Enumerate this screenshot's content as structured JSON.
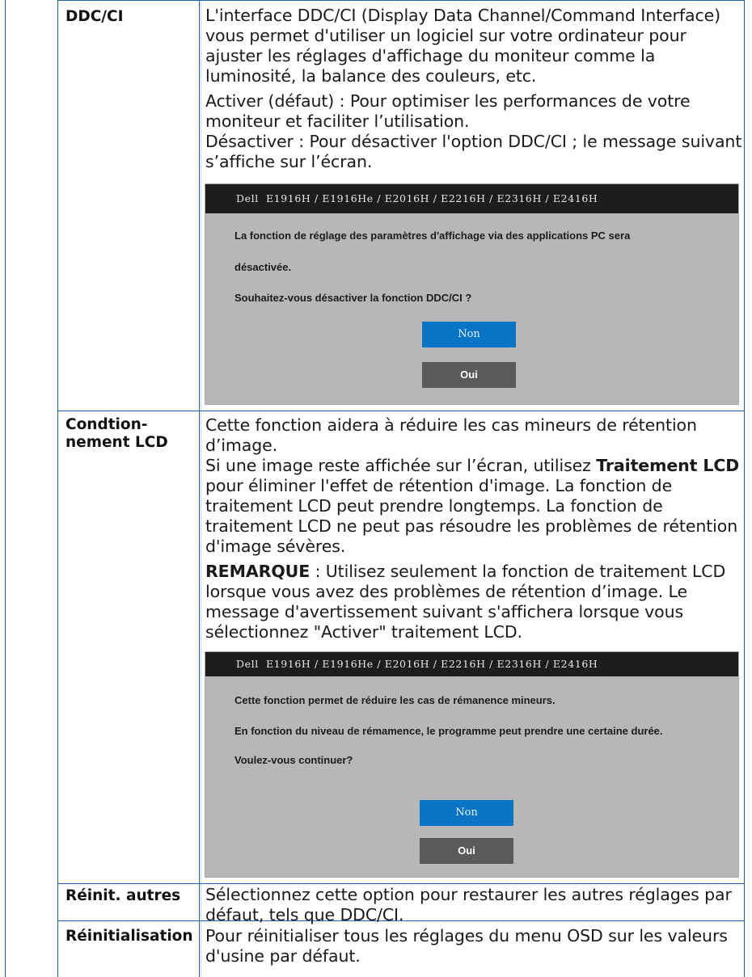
{
  "rows": [
    {
      "label": "DDC/CI",
      "paragraphs": [
        "L'interface DDC/CI (Display Data Channel/Command Interface) vous permet d'utiliser un logiciel sur votre ordinateur pour ajuster les réglages d'affichage du moniteur comme la luminosité, la balance des couleurs, etc.",
        "Activer (défaut) : Pour optimiser les performances de votre moniteur et faciliter l’utilisation.",
        "Désactiver : Pour désactiver l'option DDC/CI ; le message suivant s’affiche sur l’écran."
      ],
      "dialog": {
        "header": "Dell  E1916H / E1916He / E2016H / E2216H / E2316H / E2416H",
        "lines": [
          "La fonction de réglage des paramètres d'affichage via des applications PC sera",
          "désactivée.",
          "Souhaitez-vous désactiver la fonction DDC/CI ?"
        ],
        "button_no": "Non",
        "button_yes": "Oui"
      }
    },
    {
      "label_line1": "Condtion-",
      "label_line2": "nement LCD",
      "p1": "Cette fonction aidera à réduire les cas mineurs de rétention d’image.",
      "p2_pre": "Si une image reste affichée sur l’écran, utilisez ",
      "p2_bold": "Traitement LCD",
      "p2_post": " pour éliminer l'effet de rétention d'image. La fonction de traitement LCD peut prendre longtemps. La fonction de traitement LCD ne peut pas résoudre les problèmes de rétention d'image sévères.",
      "note_bold": "REMARQUE",
      "note_text": " : Utilisez seulement la fonction de traitement LCD lorsque vous avez des problèmes de rétention d’image. Le message d'avertissement suivant s'affichera lorsque vous sélectionnez \"Activer\" traitement LCD.",
      "dialog": {
        "header": "Dell  E1916H / E1916He / E2016H / E2216H / E2316H / E2416H",
        "lines": [
          "Cette fonction permet de réduire les cas de rémanence mineurs.",
          "En fonction du niveau de rémamence, le programme peut prendre une certaine durée.",
          "Voulez-vous continuer?"
        ],
        "button_no": "Non",
        "button_yes": "Oui"
      }
    },
    {
      "label": "Réinit. autres",
      "text": "Sélectionnez cette option pour restaurer les autres réglages par défaut, tels que DDC/CI."
    },
    {
      "label": "Réinitialisation",
      "text": "Pour réinitialiser tous les réglages du menu OSD sur les valeurs d'usine par défaut."
    }
  ],
  "colors": {
    "rule": "#1f63b0",
    "osd_body": "#b7b7b7",
    "osd_header": "#1d1d1d",
    "button_no": "#0a74c4",
    "button_yes": "#5a5a5a"
  }
}
